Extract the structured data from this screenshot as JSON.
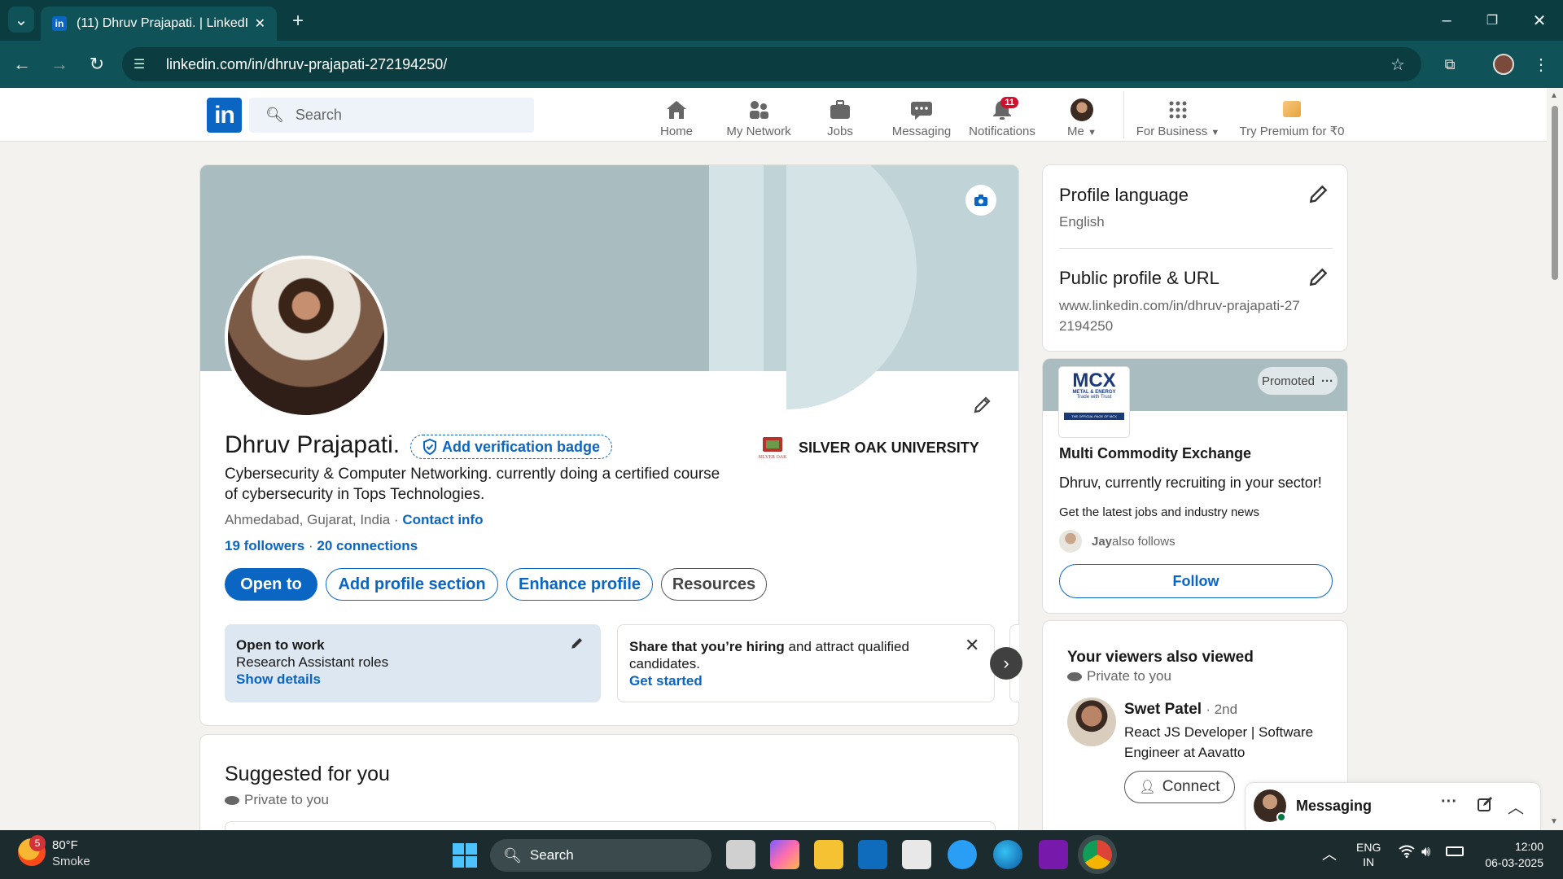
{
  "browser": {
    "tab_title": "(11) Dhruv Prajapati. | LinkedIn",
    "url": "linkedin.com/in/dhruv-prajapati-272194250/"
  },
  "linkedin_header": {
    "search_placeholder": "Search",
    "nav": {
      "home": "Home",
      "network": "My Network",
      "jobs": "Jobs",
      "messaging": "Messaging",
      "notifications": "Notifications",
      "notifications_count": "11",
      "me": "Me",
      "business": "For Business",
      "premium": "Try Premium for ₹0"
    }
  },
  "profile": {
    "name": "Dhruv Prajapati.",
    "verification": "Add verification badge",
    "headline": "Cybersecurity & Computer Networking. currently doing a certified course of cybersecurity in Tops Technologies.",
    "location": "Ahmedabad, Gujarat, India",
    "contact_info": "Contact info",
    "followers": "19 followers",
    "connections": "20 connections",
    "education": "SILVER OAK UNIVERSITY",
    "buttons": {
      "open_to": "Open to",
      "add_section": "Add profile section",
      "enhance": "Enhance profile",
      "resources": "Resources"
    },
    "open_to_work": {
      "title": "Open to work",
      "roles": "Research Assistant roles",
      "link": "Show details"
    },
    "hiring": {
      "bold": "Share that you’re hiring",
      "rest": " and attract qualified candidates.",
      "link": "Get started"
    }
  },
  "suggested": {
    "title": "Suggested for you",
    "private": "Private to you"
  },
  "sidebar": {
    "profile_language": {
      "title": "Profile language",
      "value": "English"
    },
    "public_url": {
      "title": "Public profile & URL",
      "value": "www.linkedin.com/in/dhruv-prajapati-272194250"
    },
    "ad": {
      "promoted": "Promoted",
      "logo_text": "MCX",
      "logo_sub": "METAL & ENERGY",
      "logo_tag": "Trade with Trust",
      "logo_foot": "THE OFFICIAL PAGE OF MCX",
      "company": "Multi Commodity Exchange",
      "pitch": "Dhruv, currently recruiting in your sector!",
      "sub": "Get the latest jobs and industry news",
      "follower_name": "Jay",
      "follower_text": " also follows",
      "follow_btn": "Follow"
    },
    "viewers": {
      "title": "Your viewers also viewed",
      "private": "Private to you",
      "person_name": "Swet Patel",
      "degree": "· 2nd",
      "person_title": "React JS Developer | Software Engineer at Aavatto",
      "connect": "Connect"
    }
  },
  "messaging_bar": {
    "label": "Messaging"
  },
  "taskbar": {
    "weather_temp": "80°F",
    "weather_desc": "Smoke",
    "weather_badge": "5",
    "search": "Search",
    "lang1": "ENG",
    "lang2": "IN",
    "time": "12:00",
    "date": "06-03-2025"
  },
  "colors": {
    "linkedin_blue": "#0a66c2",
    "chrome_dark": "#0b3d40",
    "chrome_mid": "#0f5257",
    "notification_red": "#cb112d"
  }
}
